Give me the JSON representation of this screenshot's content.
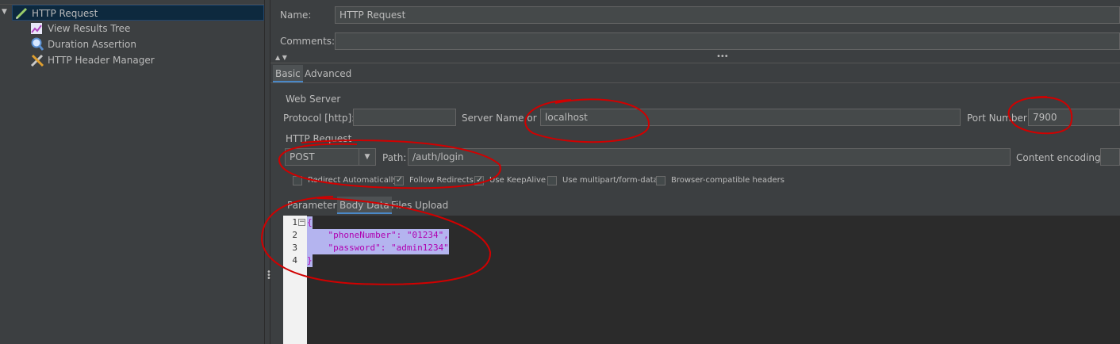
{
  "tree": {
    "items": [
      {
        "label": "HTTP Request",
        "icon": "pencil-icon"
      },
      {
        "label": "View Results Tree",
        "icon": "graph-icon"
      },
      {
        "label": "Duration Assertion",
        "icon": "magnifier-icon"
      },
      {
        "label": "HTTP Header Manager",
        "icon": "tools-icon"
      }
    ]
  },
  "form": {
    "name_label": "Name:",
    "name_value": "HTTP Request",
    "comments_label": "Comments:",
    "comments_value": ""
  },
  "tabs": {
    "basic": "Basic",
    "advanced": "Advanced"
  },
  "web_server": {
    "section_label": "Web Server",
    "protocol_label": "Protocol [http]:",
    "protocol_value": "",
    "server_label": "Server Name or IP:",
    "server_value": "localhost",
    "port_label": "Port Number:",
    "port_value": "7900"
  },
  "http_request": {
    "section_label": "HTTP Request",
    "method": "POST",
    "path_label": "Path:",
    "path_value": "/auth/login",
    "encoding_label": "Content encoding:",
    "encoding_value": "",
    "checkboxes": [
      {
        "label": "Redirect Automatically",
        "checked": false
      },
      {
        "label": "Follow Redirects",
        "checked": true
      },
      {
        "label": "Use KeepAlive",
        "checked": true
      },
      {
        "label": "Use multipart/form-data",
        "checked": false
      },
      {
        "label": "Browser-compatible headers",
        "checked": false
      }
    ]
  },
  "sub_tabs": {
    "parameters": "Parameters",
    "body_data": "Body Data",
    "files_upload": "Files Upload"
  },
  "editor": {
    "line_numbers": [
      "1",
      "2",
      "3",
      "4"
    ],
    "lines": [
      "{",
      "    \"phoneNumber\": \"01234\",",
      "    \"password\": \"admin1234\"",
      "}"
    ]
  },
  "colors": {
    "selection": "#0d293e",
    "accent": "#4a88c7",
    "annotation": "#d10000"
  }
}
